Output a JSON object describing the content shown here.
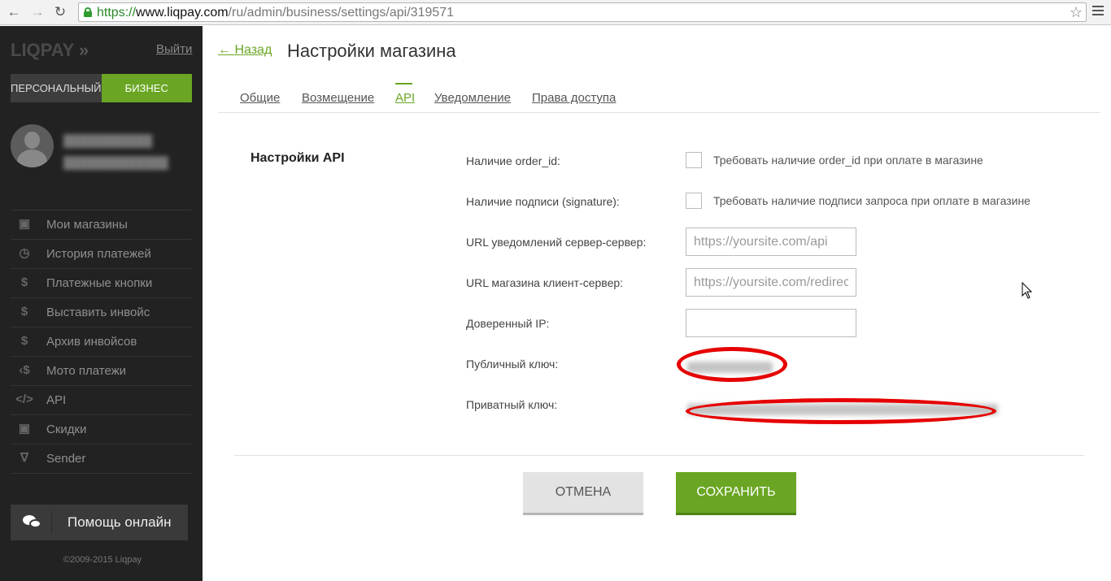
{
  "browser": {
    "url_proto": "https://",
    "url_host": "www.liqpay.com",
    "url_path": "/ru/admin/business/settings/api/319571"
  },
  "sidebar": {
    "logo": "LIQPAY",
    "logout": "Выйти",
    "toggle": {
      "personal": "ПЕРСОНАЛЬНЫЙ",
      "business": "БИЗНЕС"
    },
    "items": [
      {
        "label": "Мои магазины",
        "icon": "store-icon"
      },
      {
        "label": "История платежей",
        "icon": "history-icon"
      },
      {
        "label": "Платежные кнопки",
        "icon": "dollar-button-icon"
      },
      {
        "label": "Выставить инвойс",
        "icon": "invoice-icon"
      },
      {
        "label": "Архив инвойсов",
        "icon": "invoice-archive-icon"
      },
      {
        "label": "Мото платежи",
        "icon": "moto-icon"
      },
      {
        "label": "API",
        "icon": "code-icon"
      },
      {
        "label": "Скидки",
        "icon": "discount-store-icon"
      },
      {
        "label": "Sender",
        "icon": "sender-icon"
      }
    ],
    "help": "Помощь онлайн",
    "copyright": "©2009-2015 Liqpay"
  },
  "main": {
    "back": "← Назад",
    "title": "Настройки магазина",
    "tabs": [
      "Общие",
      "Возмещение",
      "API",
      "Уведомление",
      "Права доступа"
    ],
    "active_tab": "API"
  },
  "form": {
    "section_title": "Настройки API",
    "order_id_label": "Наличие order_id:",
    "order_id_check": "Требовать наличие order_id при оплате в магазине",
    "signature_label": "Наличие подписи (signature):",
    "signature_check": "Требовать наличие подписи запроса при оплате в магазине",
    "server_url_label": "URL уведомлений сервер-сервер:",
    "server_url_placeholder": "https://yoursite.com/api",
    "client_url_label": "URL магазина клиент-сервер:",
    "client_url_placeholder": "https://yoursite.com/redirect",
    "trusted_ip_label": "Доверенный IP:",
    "public_key_label": "Публичный ключ:",
    "private_key_label": "Приватный ключ:"
  },
  "buttons": {
    "cancel": "ОТМЕНА",
    "save": "СОХРАНИТЬ"
  },
  "colors": {
    "accent": "#6aa623",
    "sidebar_bg": "#222222",
    "highlight": "#e60000"
  }
}
